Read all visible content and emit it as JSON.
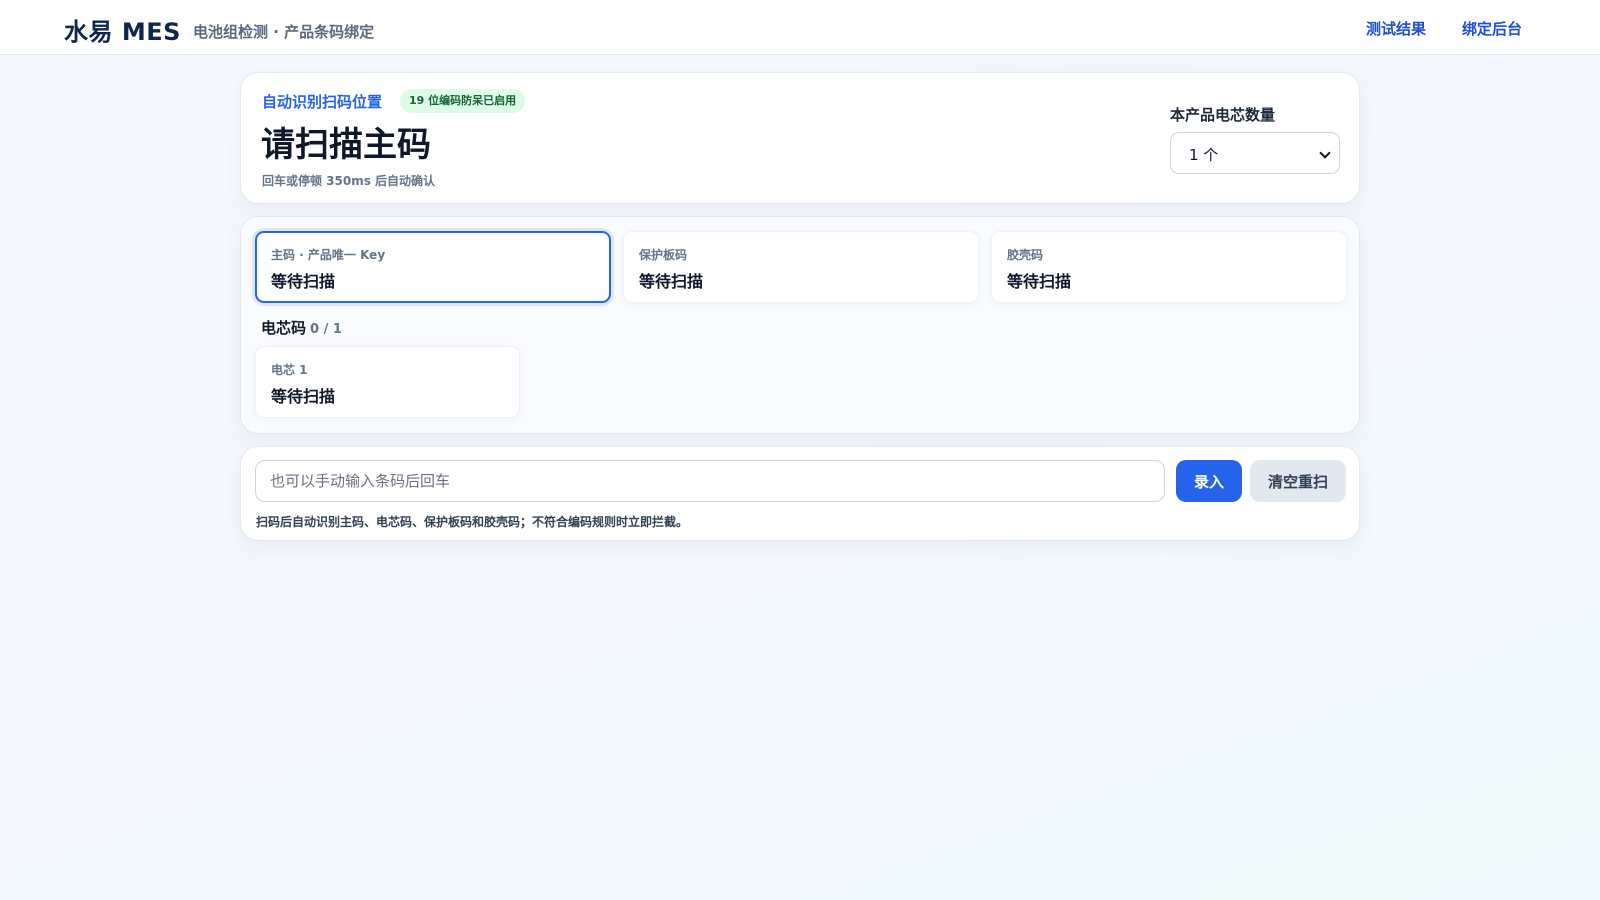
{
  "header": {
    "brand": "水易 MES",
    "subtitle": "电池组检测 · 产品条码绑定",
    "nav": {
      "results": "测试结果",
      "admin": "绑定后台"
    }
  },
  "scan_panel": {
    "auto_label": "自动识别扫码位置",
    "badge": "19 位编码防呆已启用",
    "prompt": "请扫描主码",
    "hint": "回车或停顿 350ms 后自动确认",
    "cell_count_label": "本产品电芯数量",
    "cell_count_value": "1 个"
  },
  "codes": {
    "main": {
      "label": "主码 · 产品唯一 Key",
      "value": "等待扫描"
    },
    "protect_board": {
      "label": "保护板码",
      "value": "等待扫描"
    },
    "shell": {
      "label": "胶壳码",
      "value": "等待扫描"
    },
    "cells_title": "电芯码",
    "cells_progress": "0 / 1",
    "cells": [
      {
        "label": "电芯 1",
        "value": "等待扫描"
      }
    ]
  },
  "manual_entry": {
    "placeholder": "也可以手动输入条码后回车",
    "value": "",
    "submit_label": "录入",
    "clear_label": "清空重扫",
    "hint": "扫码后自动识别主码、电芯码、保护板码和胶壳码；不符合编码规则时立即拦截。"
  },
  "colors": {
    "accent": "#2563eb",
    "badge_bg": "#dcfce7",
    "badge_text": "#166534"
  }
}
